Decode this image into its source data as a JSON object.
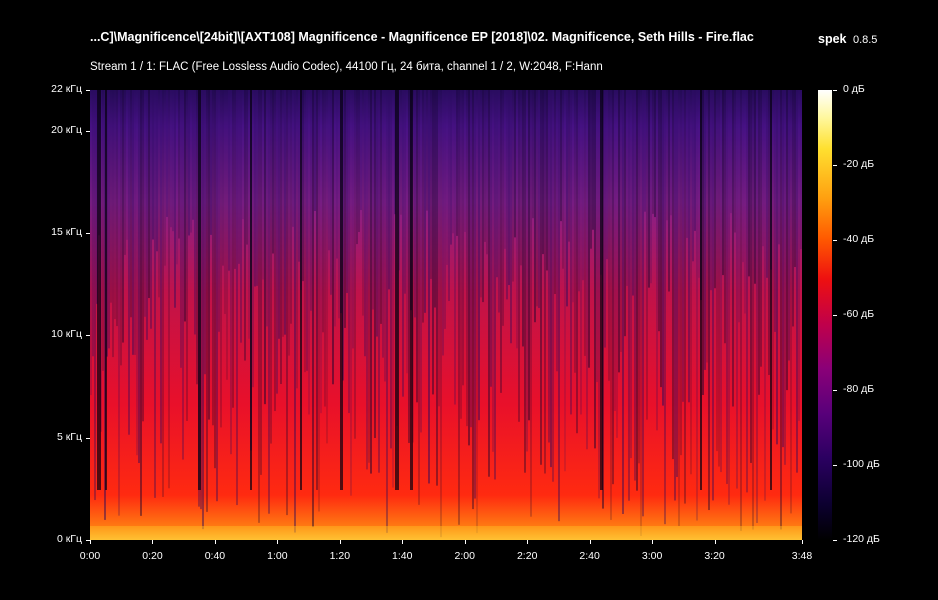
{
  "header": {
    "file_title": "...C]\\Magnificence\\[24bit]\\[AXT108] Magnificence - Magnificence EP [2018]\\02. Magnificence, Seth Hills - Fire.flac",
    "app_name": "spek",
    "app_version": "0.8.5",
    "stream_info": "Stream 1 / 1: FLAC (Free Lossless Audio Codec), 44100 Гц, 24 бита, channel 1 / 2, W:2048, F:Hann"
  },
  "axes": {
    "y_ticks": [
      {
        "value": 22,
        "label": "22 кГц"
      },
      {
        "value": 20,
        "label": "20 кГц"
      },
      {
        "value": 15,
        "label": "15 кГц"
      },
      {
        "value": 10,
        "label": "10 кГц"
      },
      {
        "value": 5,
        "label": "5 кГц"
      },
      {
        "value": 0,
        "label": "0 кГц"
      }
    ],
    "y_max": 22,
    "x_ticks": [
      {
        "value": 0,
        "label": "0:00"
      },
      {
        "value": 20,
        "label": "0:20"
      },
      {
        "value": 40,
        "label": "0:40"
      },
      {
        "value": 60,
        "label": "1:00"
      },
      {
        "value": 80,
        "label": "1:20"
      },
      {
        "value": 100,
        "label": "1:40"
      },
      {
        "value": 120,
        "label": "2:00"
      },
      {
        "value": 140,
        "label": "2:20"
      },
      {
        "value": 160,
        "label": "2:40"
      },
      {
        "value": 180,
        "label": "3:00"
      },
      {
        "value": 200,
        "label": "3:20"
      },
      {
        "value": 228,
        "label": "3:48"
      }
    ],
    "x_max": 228
  },
  "colorbar": {
    "ticks": [
      {
        "value": 0,
        "label": "0 дБ"
      },
      {
        "value": -20,
        "label": "-20 дБ"
      },
      {
        "value": -40,
        "label": "-40 дБ"
      },
      {
        "value": -60,
        "label": "-60 дБ"
      },
      {
        "value": -80,
        "label": "-80 дБ"
      },
      {
        "value": -100,
        "label": "-100 дБ"
      },
      {
        "value": -120,
        "label": "-120 дБ"
      }
    ],
    "min": -120,
    "max": 0
  }
}
